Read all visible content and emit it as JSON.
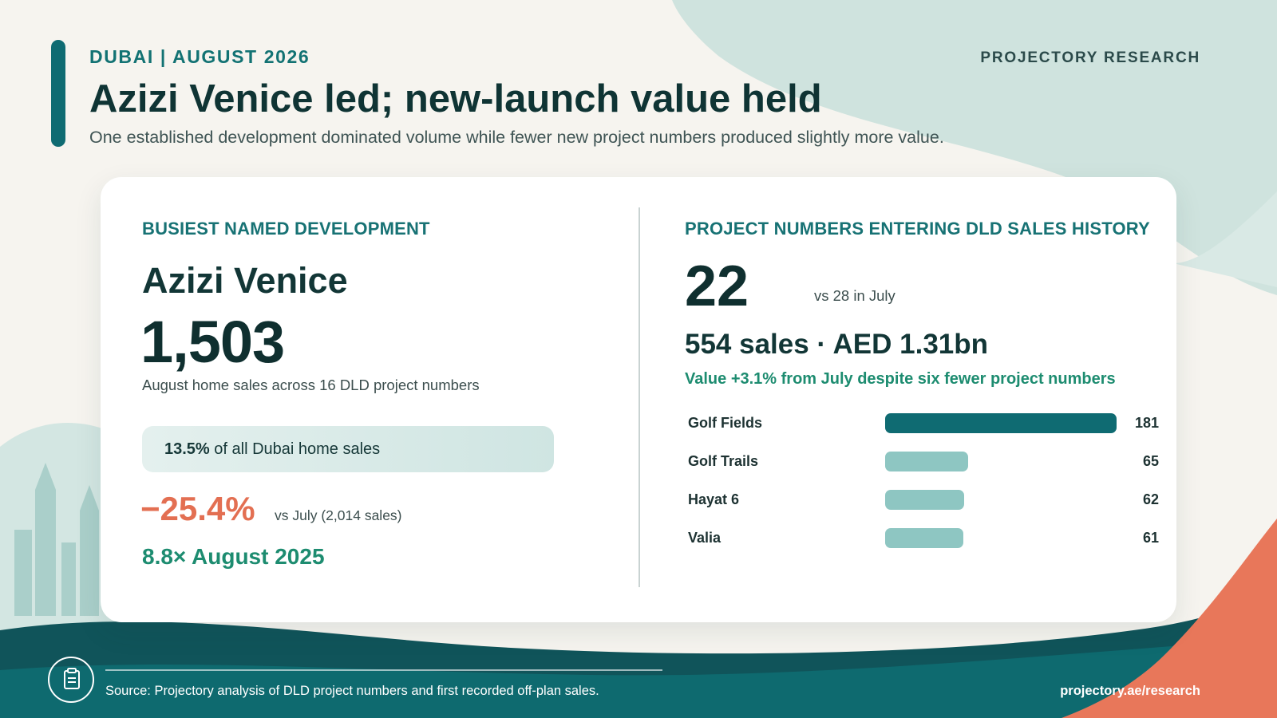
{
  "header": {
    "eyebrow": "DUBAI | AUGUST 2026",
    "brand": "PROJECTORY RESEARCH",
    "title": "Azizi Venice led; new-launch value held",
    "subtitle": "One established development dominated volume while fewer new project numbers produced slightly more value."
  },
  "left_panel": {
    "label": "BUSIEST NAMED DEVELOPMENT",
    "development": "Azizi Venice",
    "sales": "1,503",
    "sales_caption": "August home sales across 16 DLD project numbers",
    "share_value": "13.5%",
    "share_text": "of all Dubai home sales",
    "change": "−25.4%",
    "change_note": "vs July (2,014 sales)",
    "yoy": "8.8× August 2025"
  },
  "right_panel": {
    "label": "PROJECT NUMBERS ENTERING DLD SALES HISTORY",
    "count": "22",
    "count_note": "vs 28 in July",
    "sales_value": "554 sales · AED 1.31bn",
    "value_note": "Value +3.1% from July despite six fewer project numbers"
  },
  "chart_data": {
    "type": "bar",
    "orientation": "horizontal",
    "categories": [
      "Golf Fields",
      "Golf Trails",
      "Hayat 6",
      "Valia"
    ],
    "values": [
      181,
      65,
      62,
      61
    ],
    "value_labels": [
      "181",
      "65",
      "62",
      "61"
    ],
    "xlim": [
      0,
      181
    ],
    "grid": false,
    "colors": [
      "#0f6b72",
      "#8ec6c2",
      "#8ec6c2",
      "#8ec6c2"
    ]
  },
  "footer": {
    "source": "Source: Projectory analysis of DLD project numbers and first recorded off-plan sales.",
    "site": "projectory.ae/research",
    "icon": "clipboard-icon"
  },
  "colors": {
    "primary": "#0f6b72",
    "light_teal": "#8ec6c2",
    "negative": "#e36f52",
    "positive": "#1d8c70",
    "background": "#f6f4ef"
  }
}
